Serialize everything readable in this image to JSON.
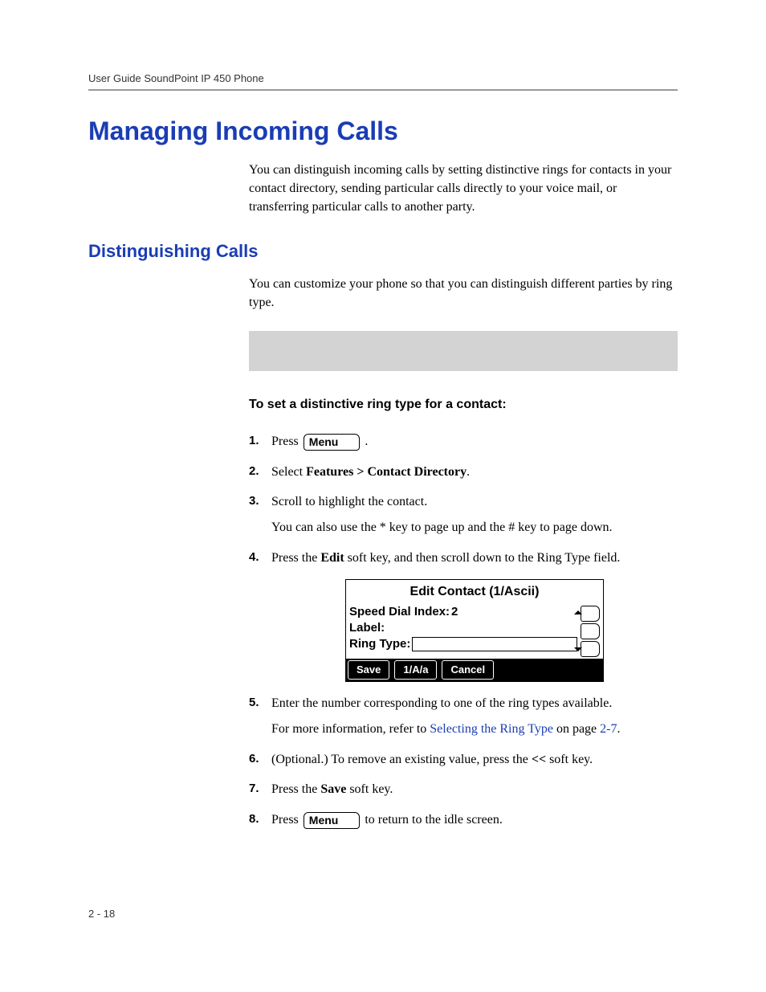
{
  "header": {
    "running": "User Guide SoundPoint IP 450 Phone"
  },
  "titles": {
    "h1": "Managing Incoming Calls",
    "h2": "Distinguishing Calls"
  },
  "paras": {
    "intro1": "You can distinguish incoming calls by setting distinctive rings for contacts in your contact directory, sending particular calls directly to your voice mail, or transferring particular calls to another party.",
    "intro2": "You can customize your phone so that you can distinguish different parties by ring type.",
    "proc_head": "To set a distinctive ring type for a contact:"
  },
  "menu_label": "Menu",
  "steps": {
    "s1_a": "Press ",
    "s1_b": " .",
    "s2_a": "Select ",
    "s2_b": "Features > Contact Directory",
    "s2_c": ".",
    "s3": "Scroll to highlight the contact.",
    "s3_sub": "You can also use the * key to page up and the # key to page down.",
    "s4_a": "Press the ",
    "s4_b": "Edit",
    "s4_c": " soft key, and then scroll down to the Ring Type field.",
    "s5": "Enter the number corresponding to one of the ring types available.",
    "s5_sub_a": "For more information, refer to ",
    "s5_sub_link": "Selecting the Ring Type",
    "s5_sub_b": " on page ",
    "s5_sub_page": "2-7",
    "s5_sub_c": ".",
    "s6_a": "(Optional.) To remove an existing value, press the ",
    "s6_b": "<<",
    "s6_c": " soft key.",
    "s7_a": "Press the ",
    "s7_b": "Save",
    "s7_c": " soft key.",
    "s8_a": "Press ",
    "s8_b": " to return to the idle screen."
  },
  "phone": {
    "title": "Edit Contact (1/Ascii)",
    "speed_label": "Speed Dial Index:",
    "speed_value": "2",
    "label_label": "Label:",
    "ring_label": "Ring Type:",
    "soft": {
      "save": "Save",
      "mode": "1/A/a",
      "cancel": "Cancel"
    }
  },
  "page_number": "2 - 18"
}
